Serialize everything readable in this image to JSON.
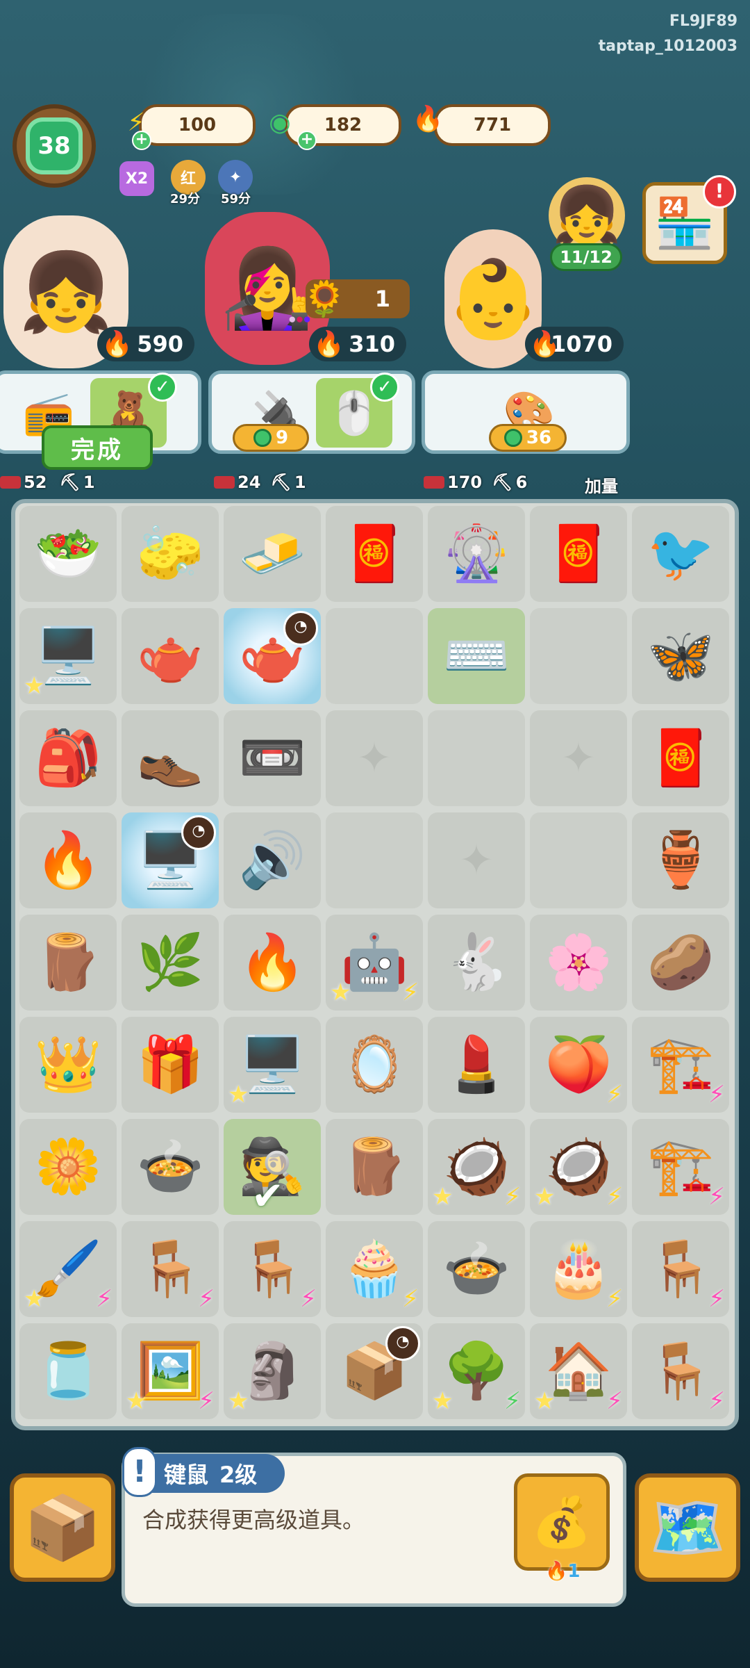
{
  "watermark": {
    "line1": "FL9JF89",
    "line2": "taptap_1012003"
  },
  "player": {
    "level": "38"
  },
  "resources": [
    {
      "name": "energy",
      "icon": "lightning-icon",
      "value": "100",
      "color": "#f5d020"
    },
    {
      "name": "coins",
      "icon": "jade-coin-icon",
      "value": "182",
      "color": "#3fc26a"
    },
    {
      "name": "spirit-flames",
      "icon": "blue-flame-icon",
      "value": "771",
      "color": "#34c5f4"
    }
  ],
  "buffs": [
    {
      "label": "X2",
      "sub": ""
    },
    {
      "label": "红",
      "sub": "29分"
    },
    {
      "label": "✦",
      "sub": "59分"
    }
  ],
  "event": {
    "progress": "11/12"
  },
  "characters": [
    {
      "name": "girl-customer",
      "value": "590",
      "emoji": "👧"
    },
    {
      "name": "opera-customer",
      "value": "310",
      "emoji": "👩‍🎤",
      "sunflower_count": "1"
    },
    {
      "name": "boy-customer",
      "value": "1070",
      "emoji": "👶"
    }
  ],
  "orders": [
    {
      "items": [
        "📻",
        "🧸"
      ],
      "reward": "",
      "done_label": "完成",
      "stats": [
        "52",
        "1"
      ]
    },
    {
      "items": [
        "🔌",
        "🖱️"
      ],
      "reward": "9",
      "stats": [
        "24",
        "1"
      ]
    },
    {
      "items": [
        "🎨"
      ],
      "reward": "36",
      "stats": [
        "170",
        "6"
      ],
      "extra": "加量"
    }
  ],
  "board": {
    "rows": [
      [
        "🥗",
        "🧽",
        "🧈",
        "🧧",
        "🎡",
        "🧧",
        "🐦"
      ],
      [
        "🖥️",
        "🫖",
        "🫖",
        "",
        "⌨️",
        "",
        "🦋"
      ],
      [
        "🎒",
        "👞",
        "📼",
        "✦",
        "",
        "✦",
        "🧧"
      ],
      [
        "🔥",
        "🖥️",
        "🔊",
        "",
        "✦",
        "",
        "🏺"
      ],
      [
        "🪵",
        "🌿",
        "🔥",
        "🤖",
        "🐇",
        "🌸",
        "🥔"
      ],
      [
        "👑",
        "🎁",
        "🖥️",
        "🪞",
        "💄",
        "🍑",
        "🏗️"
      ],
      [
        "🌼",
        "🍲",
        "🕵️",
        "🪵",
        "🥥",
        "🥥",
        "🏗️"
      ],
      [
        "🖌️",
        "🪑",
        "🪑",
        "🧁",
        "🍲",
        "🎂",
        "🪑"
      ],
      [
        "🫙",
        "🖼️",
        "🗿",
        "📦",
        "🌳",
        "🏠",
        "🪑"
      ]
    ]
  },
  "selected_item": {
    "name": "键鼠",
    "level": "2级",
    "description": "合成获得更高级道具。",
    "sell_price": "1",
    "sell_icon": "money-bag-icon"
  },
  "colors": {
    "board": "#d5d9d4",
    "gold": "#f4b433",
    "accent_blue": "#3d6fa3"
  }
}
